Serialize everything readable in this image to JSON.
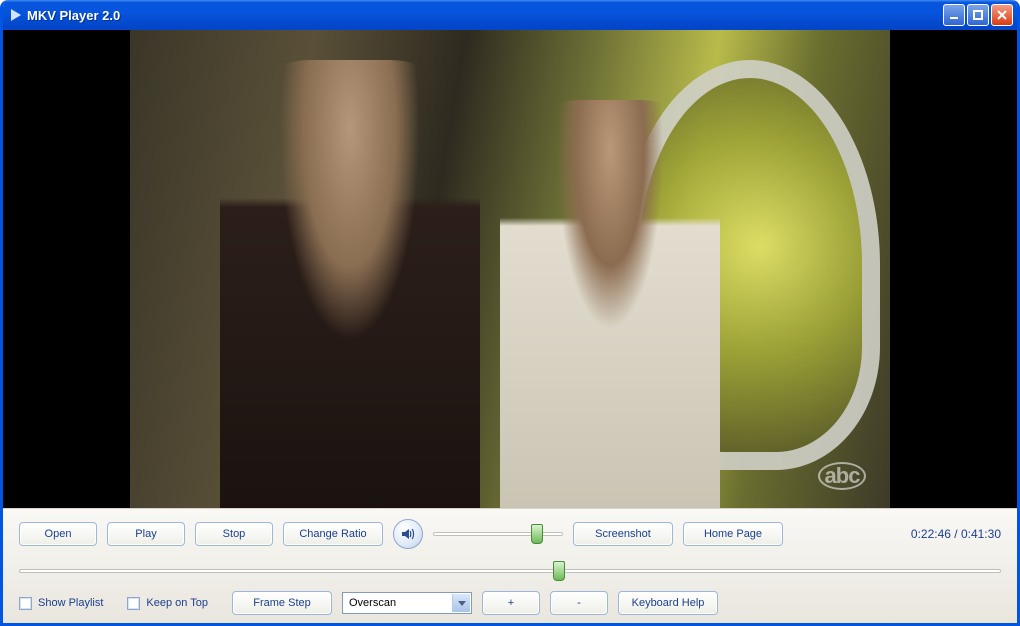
{
  "window": {
    "title": "MKV Player 2.0"
  },
  "controls": {
    "open": "Open",
    "play": "Play",
    "stop": "Stop",
    "change_ratio": "Change Ratio",
    "screenshot": "Screenshot",
    "home_page": "Home Page",
    "frame_step": "Frame Step",
    "zoom_in": "+",
    "zoom_out": "-",
    "keyboard_help": "Keyboard Help"
  },
  "checkboxes": {
    "show_playlist": "Show Playlist",
    "keep_on_top": "Keep on Top"
  },
  "select": {
    "overscan_value": "Overscan"
  },
  "time": {
    "current": "0:22:46",
    "total": "0:41:30",
    "separator": " / "
  },
  "volume": {
    "percent": 80
  },
  "seek": {
    "percent": 55
  },
  "watermark": "abc"
}
